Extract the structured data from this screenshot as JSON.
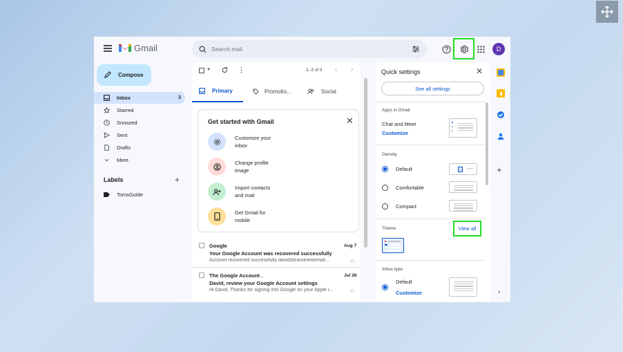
{
  "header": {
    "app_name": "Gmail",
    "search_placeholder": "Search mail",
    "avatar_letter": "D"
  },
  "compose_label": "Compose",
  "nav": [
    {
      "label": "Inbox",
      "count": "3",
      "icon": "inbox-icon"
    },
    {
      "label": "Starred",
      "icon": "star-icon"
    },
    {
      "label": "Snoozed",
      "icon": "clock-icon"
    },
    {
      "label": "Sent",
      "icon": "send-icon"
    },
    {
      "label": "Drafts",
      "icon": "draft-icon"
    },
    {
      "label": "More",
      "icon": "chevron-down-icon"
    }
  ],
  "labels": {
    "title": "Labels",
    "items": [
      "TomsGuide"
    ]
  },
  "toolbar": {
    "pagination": "1–3 of 3"
  },
  "tabs": [
    {
      "label": "Primary",
      "active": true
    },
    {
      "label": "Promotio…"
    },
    {
      "label": "Social"
    }
  ],
  "get_started": {
    "title": "Get started with Gmail",
    "items": [
      {
        "line1": "Customize your",
        "line2": "inbox",
        "bg": "#d3e3fd"
      },
      {
        "line1": "Change profile",
        "line2": "image",
        "bg": "#ffdad6"
      },
      {
        "line1": "Import contacts",
        "line2": "and mail",
        "bg": "#c4eed0"
      },
      {
        "line1": "Get Gmail for",
        "line2": "mobile",
        "bg": "#ffdf99"
      }
    ]
  },
  "emails": [
    {
      "sender": "Google",
      "date": "Aug 7",
      "subject": "Your Google Account was recovered successfully",
      "snippet": "Account recovered successfully davidsbrandnewemail..."
    },
    {
      "sender": "The Google Account .",
      "date": "Jul 26",
      "subject": "David, review your Google Account settings",
      "snippet": "Hi David, Thanks for signing into Google on your Apple i..."
    }
  ],
  "quick_settings": {
    "title": "Quick settings",
    "see_all": "See all settings",
    "apps_title": "Apps in Gmail",
    "chat_meet": "Chat and Meet",
    "customize": "Customize",
    "density_title": "Density",
    "density": [
      {
        "label": "Default",
        "selected": true
      },
      {
        "label": "Comfortable",
        "selected": false
      },
      {
        "label": "Compact",
        "selected": false
      }
    ],
    "theme_title": "Theme",
    "view_all": "View all",
    "inbox_type_title": "Inbox type",
    "inbox_default": "Default",
    "inbox_customize": "Customize"
  },
  "colors": {
    "accent": "#0b57d0",
    "highlight": "#22dd22",
    "avatar": "#5e35b1"
  }
}
